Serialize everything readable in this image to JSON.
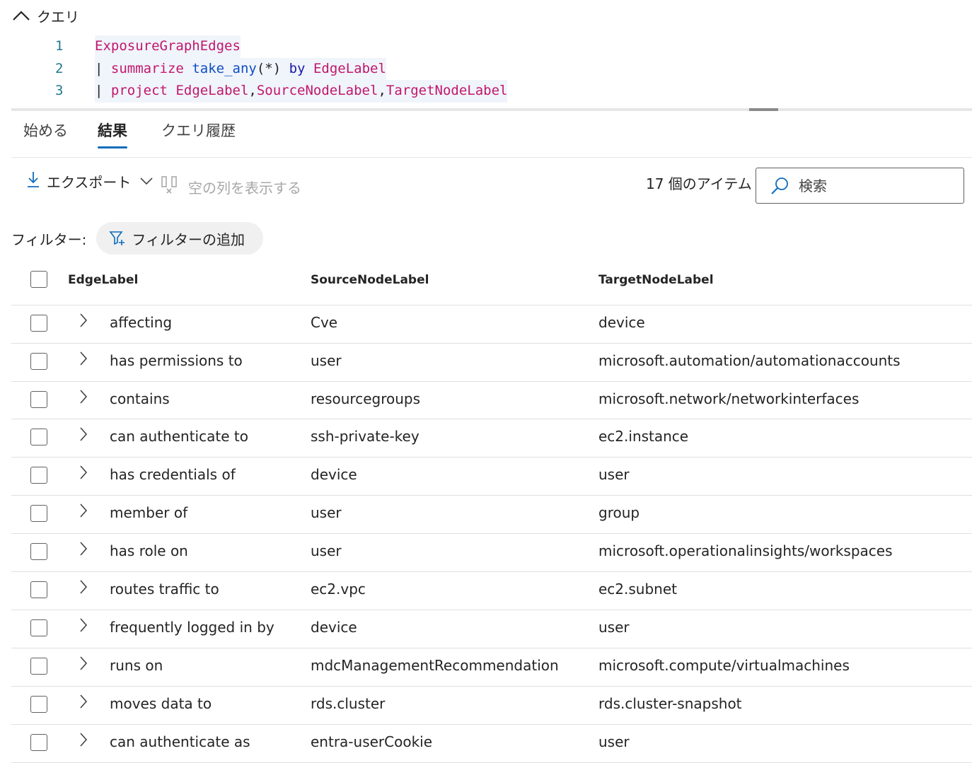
{
  "section": {
    "title": "クエリ"
  },
  "code": {
    "lines": [
      {
        "n": "1",
        "table": "ExposureGraphEdges"
      },
      {
        "n": "2",
        "pipe": "|",
        "kw": "summarize",
        "fn": "take_any",
        "args": "(*)",
        "by": "by",
        "col": "EdgeLabel"
      },
      {
        "n": "3",
        "pipe": "|",
        "kw": "project",
        "c1": "EdgeLabel",
        "sep1": ",",
        "c2": "SourceNodeLabel",
        "sep2": ",",
        "c3": "TargetNodeLabel"
      }
    ]
  },
  "tabs": [
    {
      "label": "始める",
      "active": false
    },
    {
      "label": "結果",
      "active": true
    },
    {
      "label": "クエリ履歴",
      "active": false
    }
  ],
  "toolbar": {
    "export_label": "エクスポート",
    "show_empty_label": "空の列を表示する",
    "count_label": "17 個のアイテム",
    "search_placeholder": "検索"
  },
  "filters": {
    "label": "フィルター:",
    "add_label": "フィルターの追加"
  },
  "table": {
    "columns": [
      "EdgeLabel",
      "SourceNodeLabel",
      "TargetNodeLabel"
    ],
    "rows": [
      [
        "affecting",
        "Cve",
        "device"
      ],
      [
        "has permissions to",
        "user",
        "microsoft.automation/automationaccounts"
      ],
      [
        "contains",
        "resourcegroups",
        "microsoft.network/networkinterfaces"
      ],
      [
        "can authenticate to",
        "ssh-private-key",
        "ec2.instance"
      ],
      [
        "has credentials of",
        "device",
        "user"
      ],
      [
        "member of",
        "user",
        "group"
      ],
      [
        "has role on",
        "user",
        "microsoft.operationalinsights/workspaces"
      ],
      [
        "routes traffic to",
        "ec2.vpc",
        "ec2.subnet"
      ],
      [
        "frequently logged in by",
        "device",
        "user"
      ],
      [
        "runs on",
        "mdcManagementRecommendation",
        "microsoft.compute/virtualmachines"
      ],
      [
        "moves data to",
        "rds.cluster",
        "rds.cluster-snapshot"
      ],
      [
        "can authenticate as",
        "entra-userCookie",
        "user"
      ]
    ]
  },
  "colors": {
    "accent": "#0f6cbd",
    "keyword": "#c1176c",
    "function": "#0e4ec3",
    "line_number": "#237893"
  }
}
